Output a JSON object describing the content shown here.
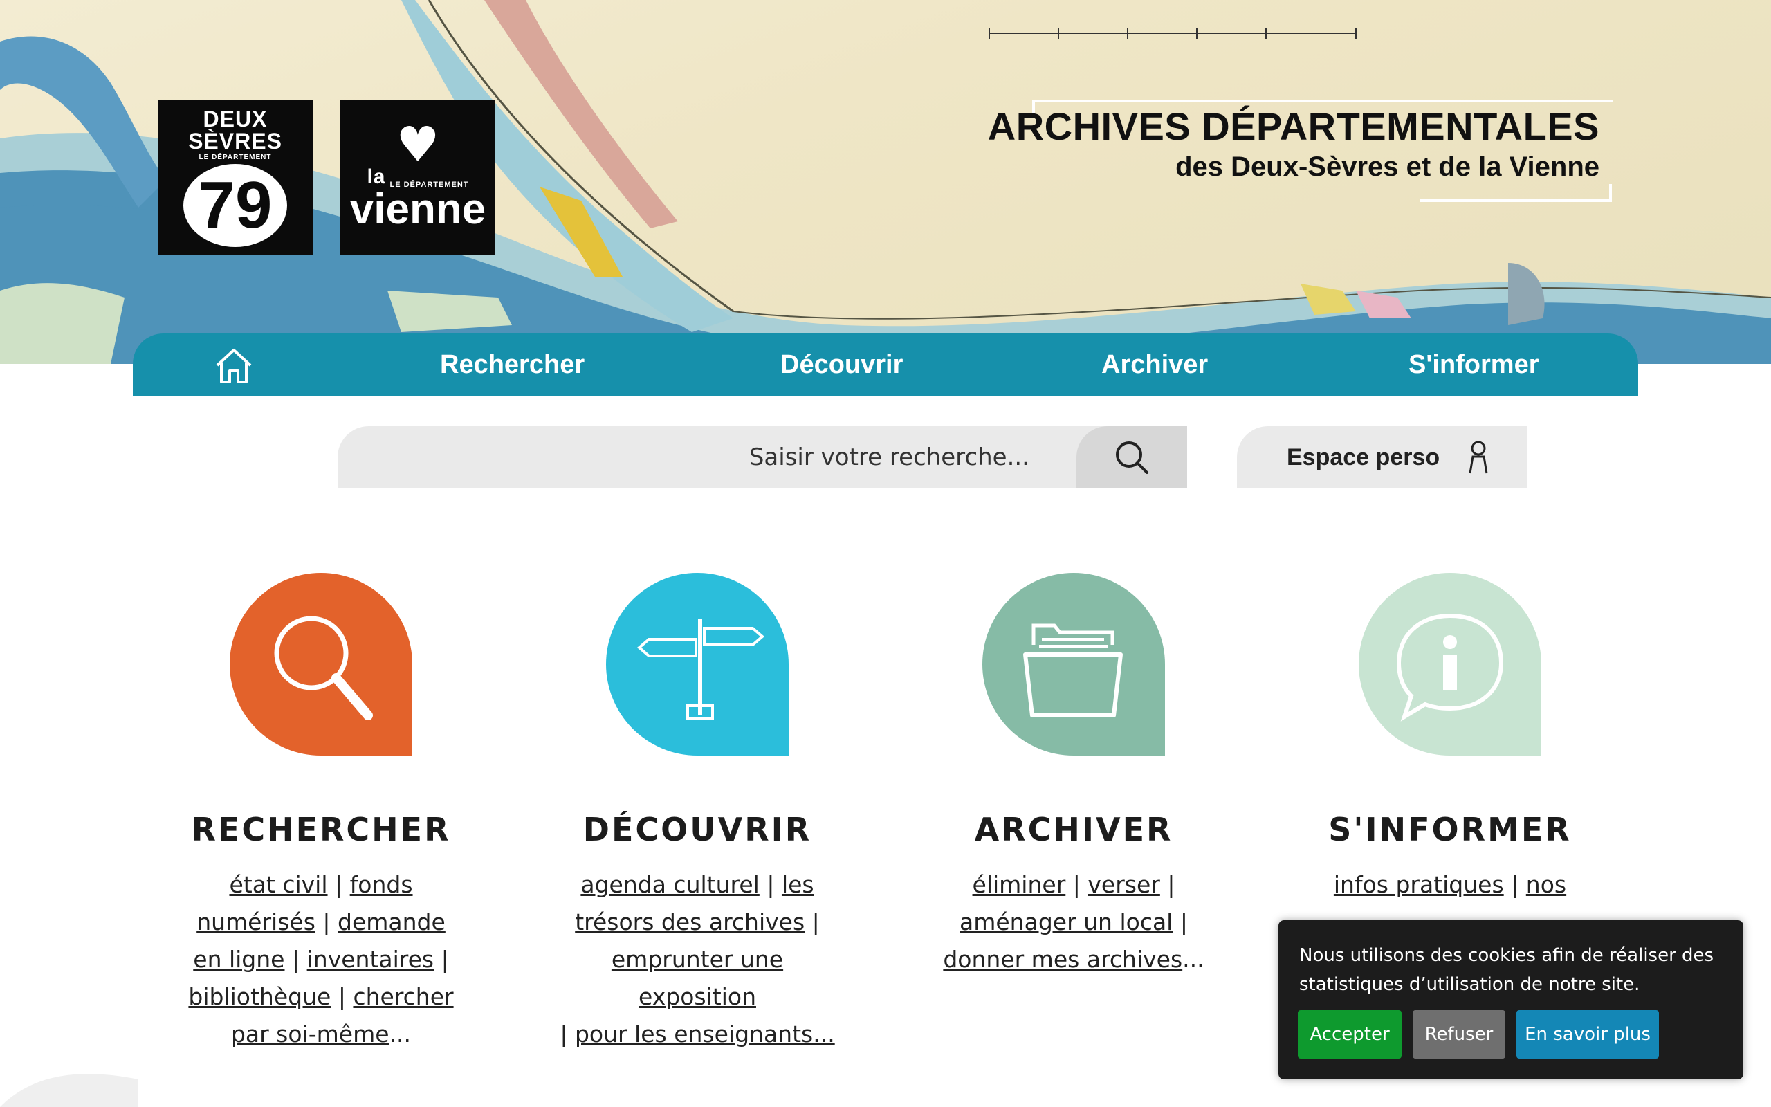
{
  "banner": {
    "logo_79": {
      "line1": "DEUX",
      "line2": "SÈVRES",
      "line3": "LE DÉPARTEMENT",
      "number": "79"
    },
    "logo_vienne": {
      "la": "la",
      "small": "LE DÉPARTEMENT",
      "big": "vienne"
    },
    "title": "ARCHIVES DÉPARTEMENTALES",
    "subtitle": "des Deux-Sèvres et de la Vienne"
  },
  "nav": {
    "home_icon": "home-icon",
    "items": [
      {
        "label": "Rechercher"
      },
      {
        "label": "Découvrir"
      },
      {
        "label": "Archiver"
      },
      {
        "label": "S'informer"
      }
    ]
  },
  "search": {
    "placeholder": "Saisir votre recherche...",
    "icon": "search-icon"
  },
  "espace_perso": {
    "label": "Espace perso",
    "icon": "user-icon"
  },
  "columns": [
    {
      "title": "RECHERCHER",
      "color": "#e3622b",
      "icon": "magnifier-icon",
      "links": [
        "état civil",
        "fonds numérisés",
        "demande en ligne",
        "inventaires",
        "bibliothèque",
        "chercher par soi-même"
      ]
    },
    {
      "title": "DÉCOUVRIR",
      "color": "#2bbedb",
      "icon": "signpost-icon",
      "links": [
        "agenda culturel",
        "les trésors des archives",
        "emprunter une exposition",
        "pour les enseignants..."
      ]
    },
    {
      "title": "ARCHIVER",
      "color": "#86bba6",
      "icon": "folder-icon",
      "links": [
        "éliminer",
        "verser",
        "aménager un local",
        "donner mes archives"
      ]
    },
    {
      "title": "S'INFORMER",
      "color": "#c8e4d2",
      "icon": "info-bubble-icon",
      "links": [
        "infos pratiques",
        "nos"
      ]
    }
  ],
  "separators": {
    "pipe": "|",
    "ellipsis": "..."
  },
  "cookie": {
    "text": "Nous utilisons des cookies afin de réaliser des statistiques d’utilisation de notre site.",
    "accept": "Accepter",
    "refuse": "Refuser",
    "more": "En savoir plus"
  },
  "colors": {
    "nav": "#1690ab",
    "accept": "#0e9a2e",
    "refuse": "#6f6f6f",
    "more": "#1487b6"
  }
}
